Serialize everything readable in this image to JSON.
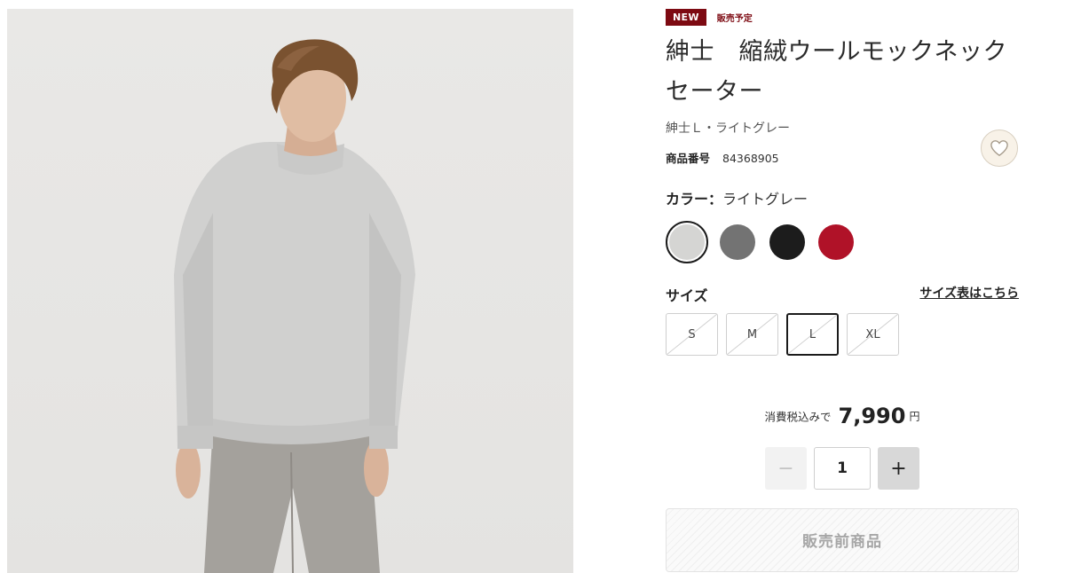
{
  "product": {
    "badge_new": "NEW",
    "badge_status": "販売予定",
    "title": "紳士　縮絨ウールモックネックセーター",
    "variant": "紳士Ｌ・ライトグレー",
    "code_label": "商品番号",
    "code_value": "84368905",
    "favorite_icon": "heart-icon"
  },
  "color": {
    "label": "カラー：",
    "selected": "ライトグレー",
    "swatches": [
      {
        "name": "light-gray",
        "hex": "#d5d5d3",
        "selected": true
      },
      {
        "name": "gray",
        "hex": "#737373",
        "selected": false
      },
      {
        "name": "black",
        "hex": "#1c1c1c",
        "selected": false
      },
      {
        "name": "red",
        "hex": "#b01228",
        "selected": false
      }
    ]
  },
  "size": {
    "label": "サイズ",
    "chart_link": "サイズ表はこちら",
    "options": [
      "S",
      "M",
      "L",
      "XL"
    ],
    "selected": "L"
  },
  "price": {
    "prefix": "消費税込みで",
    "amount": "7,990",
    "unit": "円"
  },
  "quantity": {
    "minus": "−",
    "value": "1",
    "plus": "+"
  },
  "cta": {
    "label": "販売前商品"
  },
  "colors": {
    "accent": "#7d0a12",
    "text": "#1b1b1b"
  }
}
